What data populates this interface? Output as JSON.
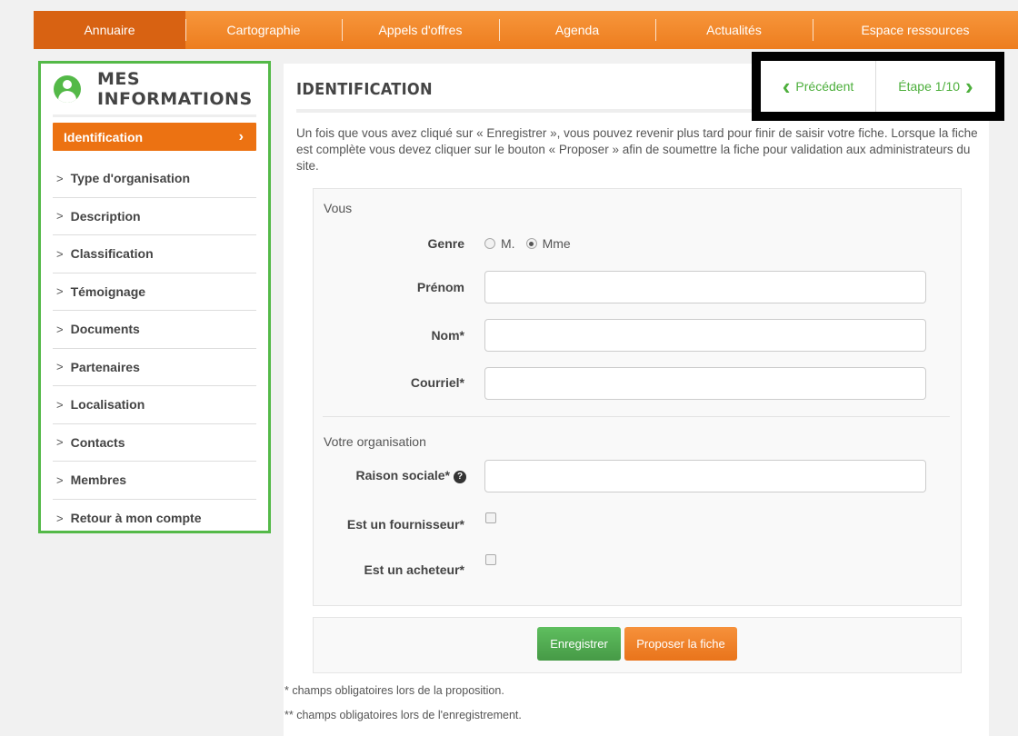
{
  "nav": {
    "items": [
      {
        "label": "Annuaire",
        "active": true
      },
      {
        "label": "Cartographie"
      },
      {
        "label": "Appels d'offres"
      },
      {
        "label": "Agenda"
      },
      {
        "label": "Actualités"
      },
      {
        "label": "Espace ressources"
      }
    ]
  },
  "sidebar": {
    "title": "MES INFORMATIONS",
    "icon": "user-circle-icon",
    "items": [
      {
        "label": "Identification",
        "active": true
      },
      {
        "label": "Type d'organisation"
      },
      {
        "label": "Description"
      },
      {
        "label": "Classification"
      },
      {
        "label": "Témoignage"
      },
      {
        "label": "Documents"
      },
      {
        "label": "Partenaires"
      },
      {
        "label": "Localisation"
      },
      {
        "label": "Contacts"
      },
      {
        "label": "Membres"
      },
      {
        "label": "Retour à mon compte"
      }
    ]
  },
  "main": {
    "title": "IDENTIFICATION",
    "intro": "Un fois que vous avez cliqué sur « Enregistrer », vous pouvez revenir plus tard pour finir de saisir votre fiche. Lorsque la fiche est complète vous devez cliquer sur le bouton « Proposer » afin de soumettre la fiche pour validation aux administrateurs du site."
  },
  "stepnav": {
    "prev_label": "Précédent",
    "step_label": "Étape 1/10"
  },
  "form": {
    "section_you": "Vous",
    "genre_label": "Genre",
    "genre_options": [
      "M.",
      "Mme"
    ],
    "genre_selected": "Mme",
    "prenom_label": "Prénom",
    "prenom_value": "",
    "nom_label": "Nom*",
    "nom_value": "",
    "courriel_label": "Courriel*",
    "courriel_value": "",
    "section_org": "Votre organisation",
    "raison_label": "Raison sociale*",
    "raison_value": "",
    "fournisseur_label": "Est un fournisseur*",
    "acheteur_label": "Est un acheteur*"
  },
  "actions": {
    "save_label": "Enregistrer",
    "propose_label": "Proposer la fiche"
  },
  "footnotes": {
    "required_propose": "* champs obligatoires lors de la proposition.",
    "required_save": "** champs obligatoires lors de l'enregistrement."
  },
  "colors": {
    "accent_orange": "#ed7d1f",
    "accent_green": "#54b948"
  }
}
